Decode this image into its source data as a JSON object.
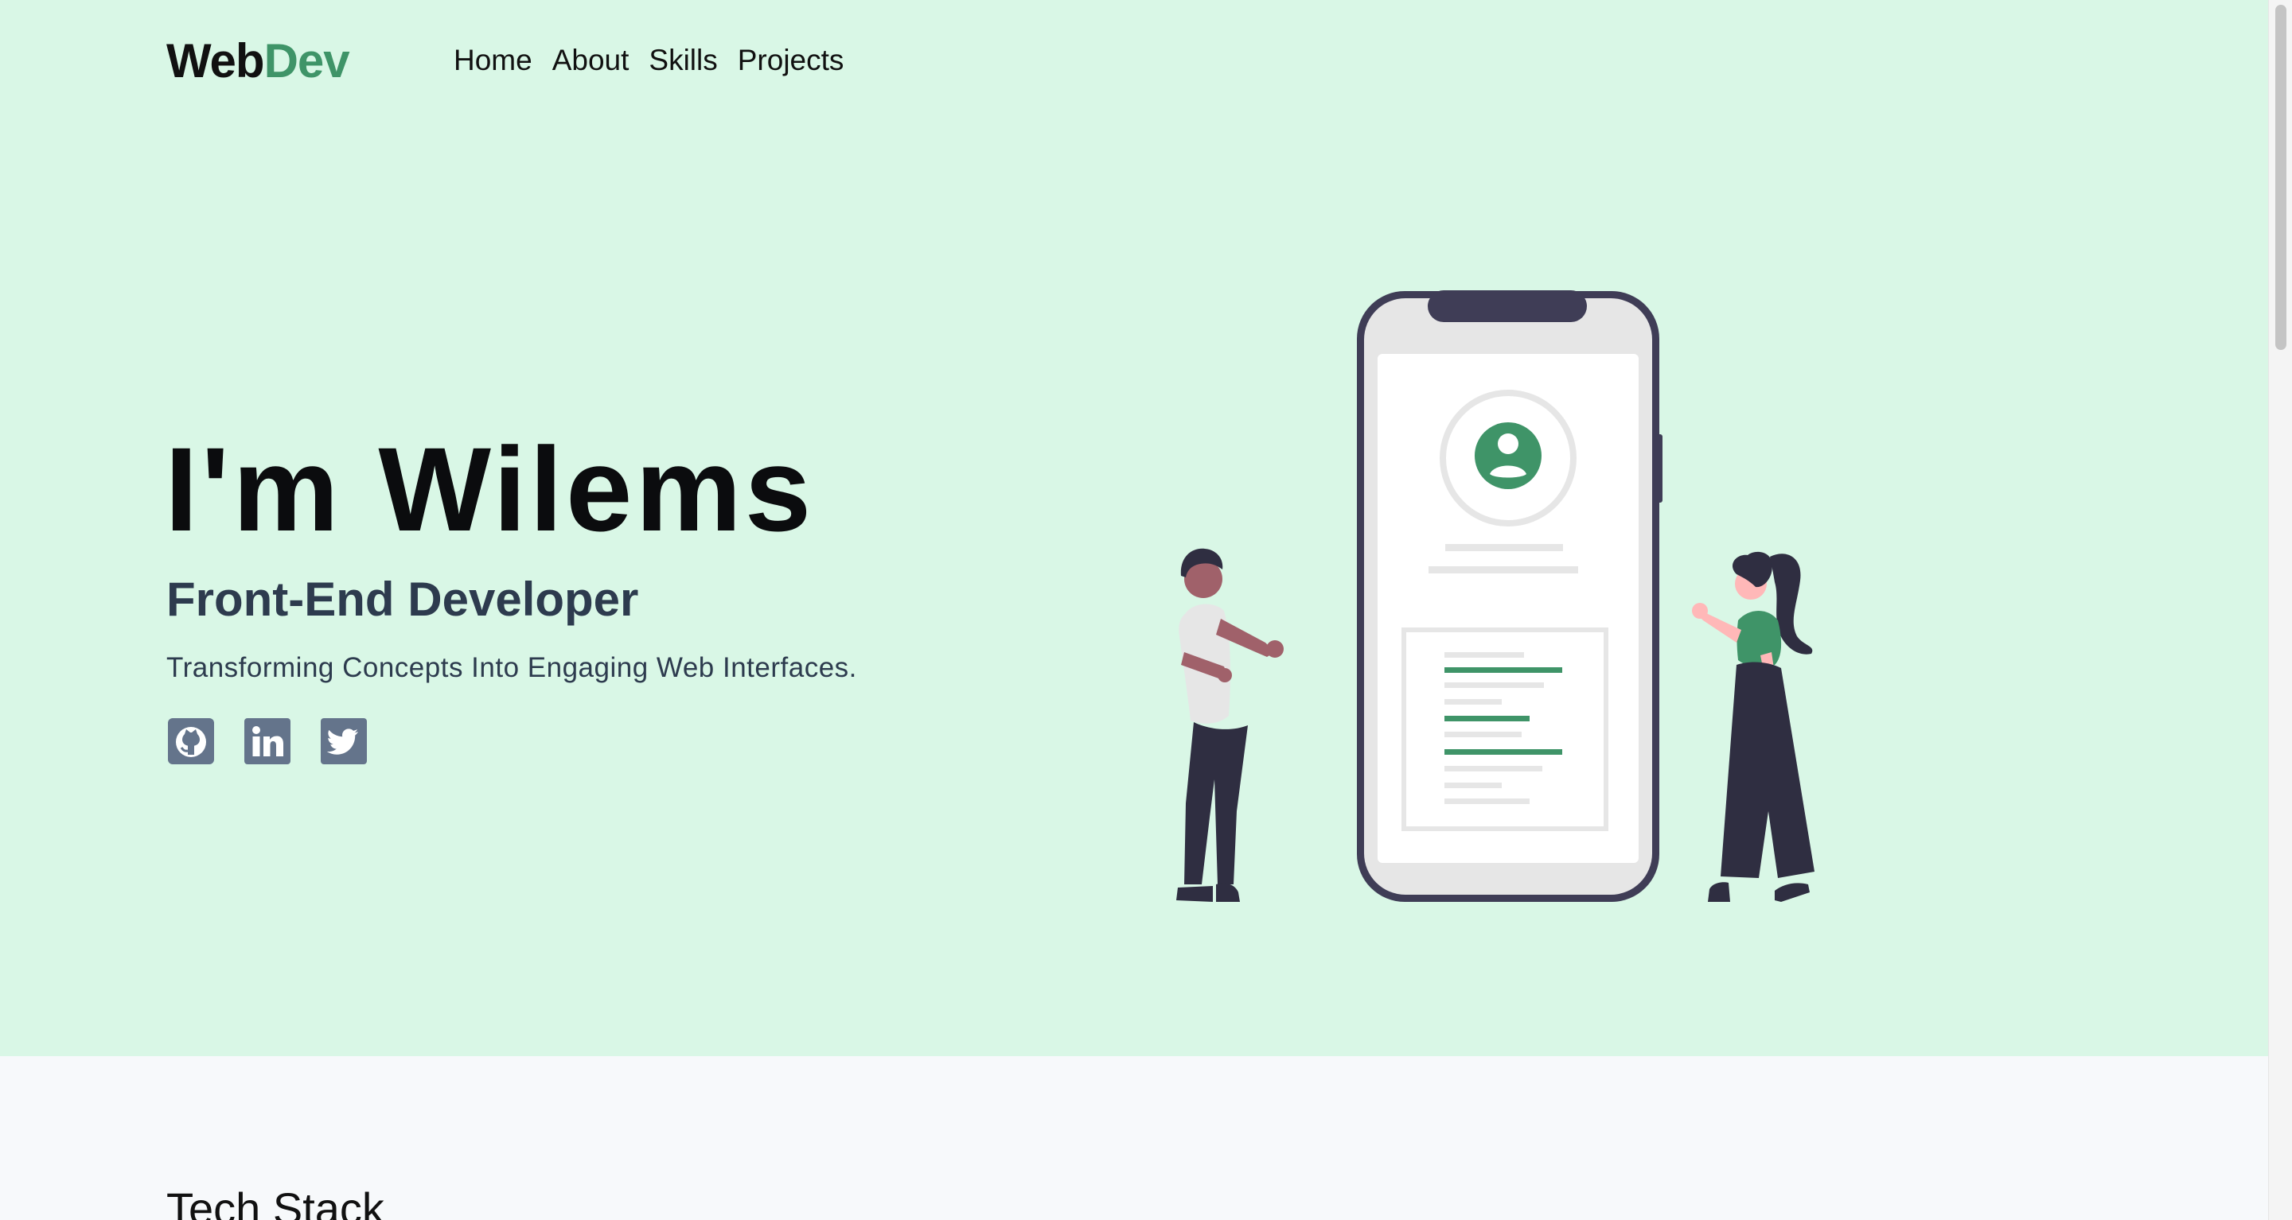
{
  "brand": {
    "part1": "Web",
    "part2": "Dev",
    "accent_color": "#3f9468"
  },
  "nav": {
    "items": [
      {
        "label": "Home"
      },
      {
        "label": "About"
      },
      {
        "label": "Skills"
      },
      {
        "label": "Projects"
      }
    ]
  },
  "hero": {
    "title": "I'm Wilems",
    "role": "Front-End Developer",
    "tagline": "Transforming Concepts Into Engaging Web Interfaces.",
    "background_color": "#d9f7e6",
    "socials": [
      {
        "icon": "github-icon"
      },
      {
        "icon": "linkedin-icon"
      },
      {
        "icon": "twitter-icon"
      }
    ]
  },
  "tech_section": {
    "title": "Tech Stack"
  }
}
